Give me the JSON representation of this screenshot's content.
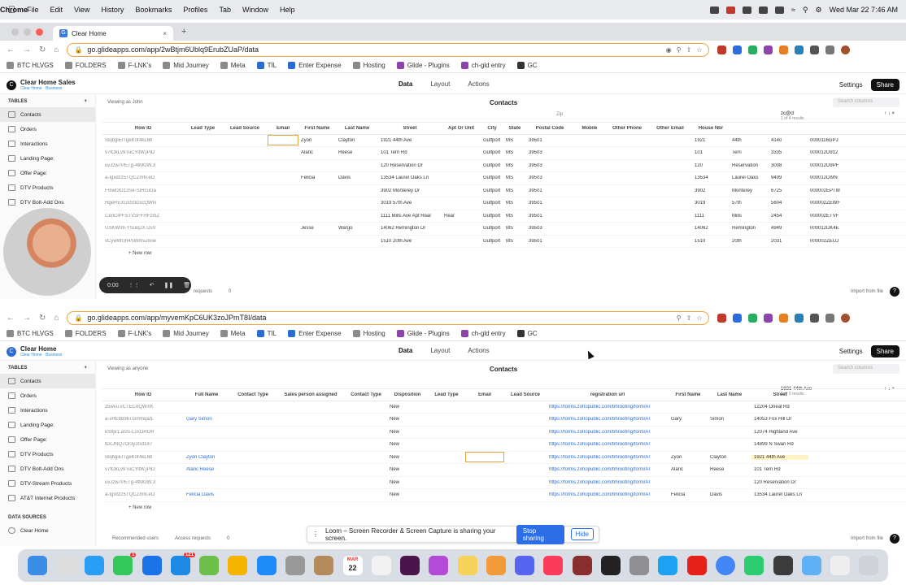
{
  "menubar": {
    "app": "Chrome",
    "items": [
      "File",
      "Edit",
      "View",
      "History",
      "Bookmarks",
      "Profiles",
      "Tab",
      "Window",
      "Help"
    ],
    "datetime": "Wed Mar 22  7:46 AM"
  },
  "bookmarks": [
    "BTC HLVGS",
    "FOLDERS",
    "F-LNK's",
    "Mid Journey",
    "Meta",
    "TIL",
    "Enter Expense",
    "Hosting",
    "Glide - Plugins",
    "ch-gld entry",
    "GC"
  ],
  "colors": {
    "accent_orange": "#f0a63a",
    "link_blue": "#2b6cd0",
    "highlight_yellow": "#fdf3c5",
    "loom_blue": "#2b6ee8"
  },
  "window1": {
    "tab_title": "Clear Home",
    "url": "go.glideapps.com/app/2wBtjm6Ublq9ErubZUaP/data",
    "app_name": "Clear Home Sales",
    "app_sub": "Clear Home · Business",
    "app_tabs": [
      "Data",
      "Layout",
      "Actions"
    ],
    "settings": "Settings",
    "share": "Share",
    "tables_label": "TABLES",
    "tables": [
      "Contacts",
      "Orders",
      "Interactions",
      "Landing Page:",
      "Offer Page:",
      "DTV Products",
      "DTV Bolt-Add Ons"
    ],
    "viewing_as": "Viewing as John",
    "grid_title": "Contacts",
    "search_placeholder": "Search columns",
    "group_label": "Zip",
    "find_text": "zc@cl",
    "find_count": "1 of 4 results",
    "columns": [
      "Row ID",
      "Lead Type",
      "Lead Source",
      "Email",
      "First Name",
      "Last Name",
      "Street",
      "Apt Or Unit",
      "City",
      "State",
      "Postal Code",
      "Mobile",
      "Other Phone",
      "Other Email",
      "House Nbr",
      "",
      "",
      ""
    ],
    "rows": [
      [
        "SlqbgiEtTgeK0r4kL6b",
        "",
        "",
        "",
        "Zyon",
        "Clayton",
        "1921 44th Ave",
        "",
        "Gulfport",
        "MS",
        "39501",
        "",
        "",
        "",
        "1921",
        "44th",
        "4140",
        "0000116GPJ"
      ],
      [
        "v7fOkLv9TuCYitW.jPiD",
        "",
        "",
        "",
        "Alaric",
        "Reese",
        "101 Terri Rd",
        "",
        "Gulfport",
        "MS",
        "39503",
        "",
        "",
        "",
        "101",
        "Terri",
        "3335",
        "000012D912"
      ],
      [
        "uvJzw7PETg-4tMGW.3",
        "",
        "",
        "",
        "",
        "",
        "120 Reservation Dr",
        "",
        "Gulfport",
        "MS",
        "39503",
        "",
        "",
        "",
        "120",
        "Reservation",
        "3008",
        "000012D9PF"
      ],
      [
        "a-Igxdzz5TQCZmN.eO",
        "",
        "",
        "",
        "Felicia",
        "Davis",
        "13534 Laurel Oaks Ln",
        "",
        "Gulfport",
        "MS",
        "39503",
        "",
        "",
        "",
        "13534",
        "Laurel Oaks",
        "9499",
        "000012DI9N"
      ],
      [
        "Fmwt3O13Se-SIRcuGa",
        "",
        "",
        "",
        "",
        "",
        "3902 Monterey Dr",
        "",
        "Gulfport",
        "MS",
        "39501",
        "",
        "",
        "",
        "3902",
        "Monterey",
        "6725",
        "000002EPTM"
      ],
      [
        "HgeREXUsS0izscQWN",
        "",
        "",
        "",
        "",
        "",
        "3019 57th Ave",
        "",
        "Gulfport",
        "MS",
        "39501",
        "",
        "",
        "",
        "3019",
        "57th",
        "5604",
        "000002ZEWF"
      ],
      [
        "CenClPFSTVSFFHFzmZ",
        "",
        "",
        "",
        "",
        "",
        "1111 Mills Ave Apt Rear",
        "Rear",
        "Gulfport",
        "MS",
        "39501",
        "",
        "",
        "",
        "1111",
        "Mills",
        "2454",
        "000002ETVF"
      ],
      [
        "USKW0b-YSuiqJX.lJsV",
        "",
        "",
        "",
        "Jesse",
        "Wargo",
        "14062 Remington Dr",
        "",
        "Gulfport",
        "MS",
        "39503",
        "",
        "",
        "",
        "14062",
        "Remington",
        "4949",
        "000012DK4E"
      ],
      [
        "vCywWGh4SWmvZ6oe",
        "",
        "",
        "",
        "",
        "",
        "1510 20th Ave",
        "",
        "Gulfport",
        "MS",
        "39501",
        "",
        "",
        "",
        "1510",
        "20th",
        "2031",
        "000002ZEUJ"
      ]
    ],
    "new_row": "+ New row",
    "requests": "requests",
    "requests_count": "0",
    "import": "Import from file",
    "rec_time": "0:00"
  },
  "window2": {
    "url": "go.glideapps.com/app/myvemKpC6UK3zoJPmT8I/data",
    "app_name": "Clear Home",
    "app_sub": "Clear Home · Business",
    "app_tabs": [
      "Data",
      "Layout",
      "Actions"
    ],
    "settings": "Settings",
    "share": "Share",
    "tables_label": "TABLES",
    "tables": [
      "Contacts",
      "Orders",
      "Interactions",
      "Landing Page:",
      "Offer Page:",
      "DTV Products",
      "DTV Bolt-Add Ons",
      "DTV-Stream Products",
      "AT&T Internet Products"
    ],
    "data_sources_label": "DATA SOURCES",
    "data_source": "Clear Home",
    "viewing_as": "Viewing as anyone",
    "grid_title": "Contacts",
    "search_placeholder": "Search columns",
    "find_text": "1921 44th Ave",
    "find_count": "1 of 3 results",
    "columns": [
      "Row ID",
      "Full Name",
      "Contact Type",
      "Sales person assigned",
      "Contact Type",
      "Disposition",
      "Lead Type",
      "Email",
      "Lead Source",
      "registration url",
      "First Name",
      "Last Name",
      "Street"
    ],
    "rows": [
      [
        "z5wvu.vCTECoQWXK",
        "",
        "",
        "",
        "",
        "New",
        "",
        "",
        "",
        "https://forms.zohopublic.com/bhroofing/form/AT",
        "",
        "",
        "12204 Oneal Rd"
      ],
      [
        "a-vHE8896TGmlnqarL",
        "Gary Simon",
        "",
        "",
        "",
        "New",
        "",
        "",
        "",
        "https://forms.zohopublic.com/bhroofing/form/AT",
        "Gary",
        "Simon",
        "14053 Fox Hill Dr"
      ],
      [
        "kS9jx1.aSS-L2xOROR",
        "",
        "",
        "",
        "",
        "New",
        "",
        "",
        "",
        "https://forms.zohopublic.com/bhroofing/form/AT",
        "",
        "",
        "12074 Highland Ave"
      ],
      [
        "fDcJNQ7Or3y3Sd187",
        "",
        "",
        "",
        "",
        "New",
        "",
        "",
        "",
        "https://forms.zohopublic.com/bhroofing/form/AT",
        "",
        "",
        "14899 N Swan Rd"
      ],
      [
        "SlqbgiEtTgeK0r4kL6b",
        "Zyon Clayton",
        "",
        "",
        "",
        "New",
        "",
        "",
        "",
        "https://forms.zohopublic.com/bhroofing/form/AT",
        "Zyon",
        "Clayton",
        "1921 44th Ave"
      ],
      [
        "v7fOkLv9TuCYitW.jPiD",
        "Alaric Reese",
        "",
        "",
        "",
        "New",
        "",
        "",
        "",
        "https://forms.zohopublic.com/bhroofing/form/AT",
        "Alaric",
        "Reese",
        "101 Terri Rd"
      ],
      [
        "uvJzw7PETg-4tMGW.3",
        "",
        "",
        "",
        "",
        "New",
        "",
        "",
        "",
        "https://forms.zohopublic.com/bhroofing/form/AT",
        "",
        "",
        "120 Reservation Dr"
      ],
      [
        "a-Igxdzz5TQCZmN.eO",
        "Felicia Davis",
        "",
        "",
        "",
        "New",
        "",
        "",
        "",
        "https://forms.zohopublic.com/bhroofing/form/AT",
        "Felicia",
        "Davis",
        "13534 Laurel Oaks Ln"
      ]
    ],
    "new_row": "+ New row",
    "recommended_users": "Recommended users",
    "access_requests": "Access requests",
    "access_count": "0",
    "import": "Import from file"
  },
  "loom": {
    "message": "Loom – Screen Recorder & Screen Capture is sharing your screen.",
    "stop": "Stop sharing",
    "hide": "Hide"
  },
  "dock": {
    "badge_messages": "1",
    "badge_mail": "121",
    "calendar_month": "MAR",
    "calendar_day": "22"
  }
}
